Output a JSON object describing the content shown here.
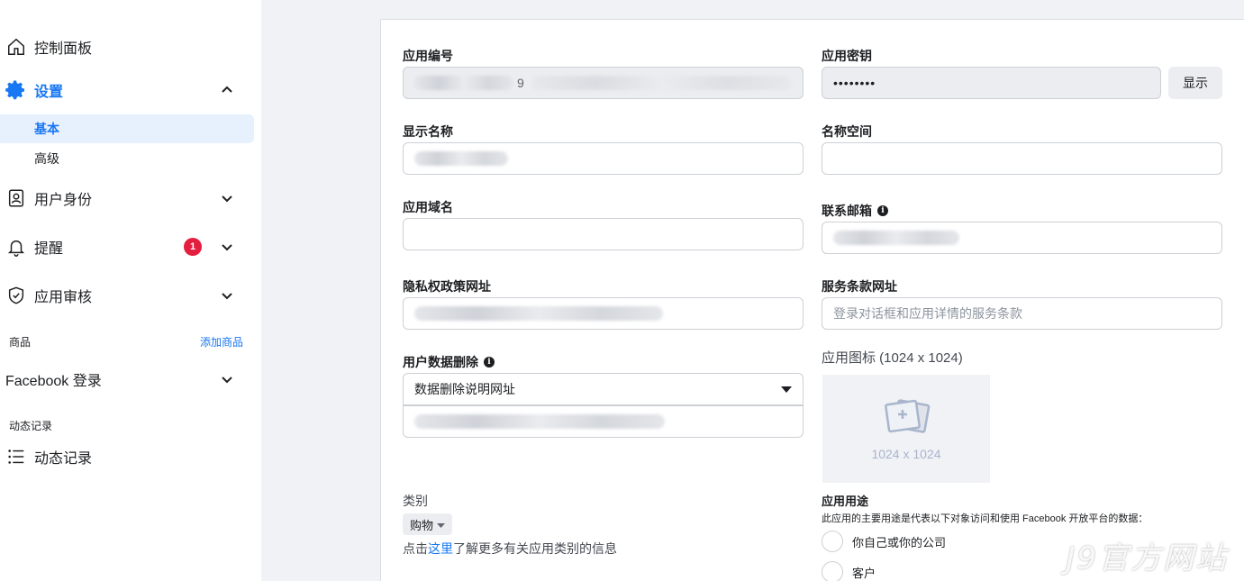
{
  "sidebar": {
    "dashboard": {
      "label": "控制面板",
      "icon": "home-icon"
    },
    "settings": {
      "label": "设置",
      "icon": "gear-icon",
      "color": "#1877f2"
    },
    "settings_sub": [
      {
        "label": "基本"
      },
      {
        "label": "高级"
      }
    ],
    "user_roles": {
      "label": "用户身份",
      "icon": "id-card-icon"
    },
    "alerts": {
      "label": "提醒",
      "icon": "bell-icon",
      "badge": "1"
    },
    "app_review": {
      "label": "应用审核",
      "icon": "shield-check-icon"
    },
    "products_section": {
      "label": "商品",
      "add_link": "添加商品"
    },
    "facebook_login": {
      "label": "Facebook 登录"
    },
    "activity_section": {
      "label": "动态记录"
    },
    "activity_log": {
      "label": "动态记录",
      "icon": "list-icon"
    }
  },
  "form": {
    "app_id": {
      "label": "应用编号",
      "value_suffix": "9"
    },
    "app_secret": {
      "label": "应用密钥",
      "value": "••••••••",
      "show_button": "显示"
    },
    "display_name": {
      "label": "显示名称"
    },
    "namespace": {
      "label": "名称空间"
    },
    "app_domains": {
      "label": "应用域名"
    },
    "contact_email": {
      "label": "联系邮箱"
    },
    "privacy_url": {
      "label": "隐私权政策网址"
    },
    "terms_url": {
      "label": "服务条款网址",
      "placeholder": "登录对话框和应用详情的服务条款"
    },
    "data_deletion": {
      "label": "用户数据删除",
      "selected": "数据删除说明网址"
    },
    "app_icon": {
      "label": "应用图标 (1024 x 1024)",
      "dims": "1024 x 1024"
    },
    "category": {
      "label": "类别",
      "selected": "购物",
      "help_prefix": "点击",
      "help_link": "这里",
      "help_suffix": "了解更多有关应用类别的信息"
    },
    "app_purpose": {
      "label": "应用用途",
      "hint": "此应用的主要用途是代表以下对象访问和使用 Facebook 开放平台的数据：",
      "options": [
        "你自己或你的公司",
        "客户"
      ]
    }
  },
  "watermark": "J9官方网站"
}
